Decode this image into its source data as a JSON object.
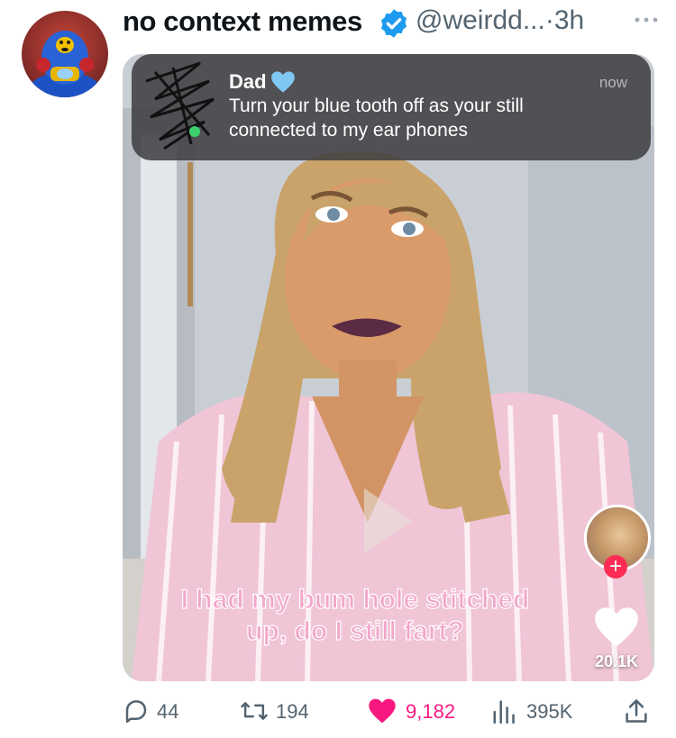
{
  "author": {
    "name": "no context memes",
    "handle": "@weirdd...",
    "separator": "·",
    "time": "3h"
  },
  "colors": {
    "verified": "#1d9bf0",
    "like": "#f91880",
    "caption": "#f2a6c9",
    "tiktok_plus": "#fe2c55"
  },
  "media": {
    "notification": {
      "from": "Dad",
      "emoji": "blue-heart",
      "time": "now",
      "body": "Turn your blue tooth off as your still connected to my ear phones"
    },
    "caption_lines": [
      "I had my bum hole stitched",
      "up, do I still fart?"
    ],
    "side_like_count": "20.1K",
    "side_plus": "+"
  },
  "actions": {
    "replies": "44",
    "reposts": "194",
    "likes": "9,182",
    "views": "395K"
  },
  "icons": [
    "verified-badge-icon",
    "more-icon",
    "reply-icon",
    "repost-icon",
    "like-icon",
    "views-icon",
    "share-icon",
    "play-icon",
    "blue-heart-icon"
  ]
}
